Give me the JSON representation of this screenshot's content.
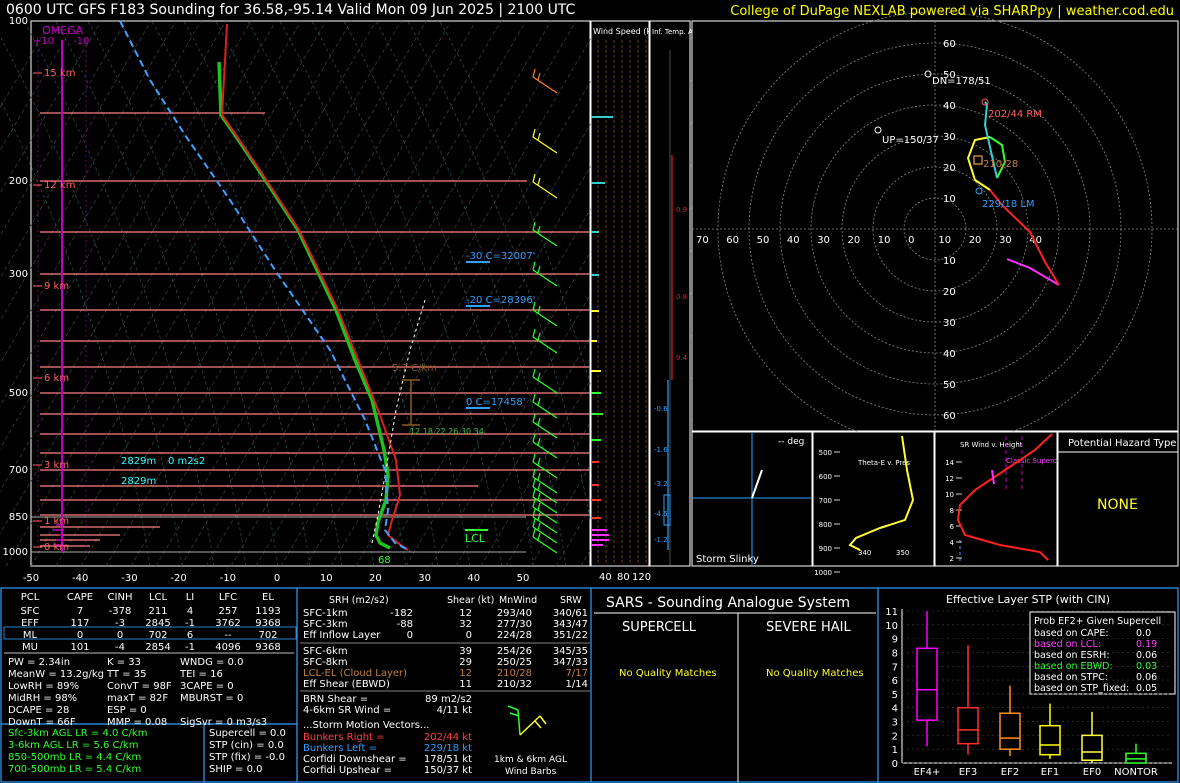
{
  "header": {
    "title": "0600 UTC GFS F183 Sounding for 36.58,-95.14 Valid  Mon 09 Jun 2025 | 2100 UTC",
    "credit": "College of DuPage NEXLAB powered via SHARPpy | weather.cod.edu"
  },
  "skewt": {
    "pressure_ticks": [
      "100",
      "200",
      "300",
      "500",
      "700",
      "850",
      "1000"
    ],
    "temp_ticks": [
      "-50",
      "-40",
      "-30",
      "-20",
      "-10",
      "0",
      "10",
      "20",
      "30",
      "40",
      "50"
    ],
    "height_labels": [
      "15 km",
      "12 km",
      "9 km",
      "6 km",
      "3 km",
      "1 km",
      "0 km"
    ],
    "omega_label": "OMEGA",
    "omega_ticks": [
      "+10",
      "-10"
    ],
    "annotations": {
      "wet_bulb_zero_1": "-30 C=32007'",
      "wet_bulb_zero_2": "-20 C=28396'",
      "freezing": "0 C=17458'",
      "lapse_max": "5.7 C/km",
      "eff_inflow_1": "2829m",
      "eff_inflow_srh": "0 m2s2",
      "eff_inflow_2": "2829m",
      "lcl": "LCL",
      "surface_temp": "68",
      "dendritic": "12  18  22 26 30 34"
    }
  },
  "wind_speed_panel": {
    "title": "Wind Speed (knots)",
    "ticks": [
      "40",
      "80",
      "120"
    ]
  },
  "temp_adv_panel": {
    "title": "Inf. Temp. Adv. (C/hr)",
    "values": [
      "0.9",
      "0.8",
      "0.4",
      "-0.6",
      "-1.6",
      "-3.2",
      "-4.5",
      "-1.2"
    ]
  },
  "hodograph": {
    "ring_labels": [
      "10",
      "20",
      "30",
      "40",
      "50",
      "60"
    ],
    "x_axis_labels": [
      "70",
      "60",
      "50",
      "40",
      "30",
      "20",
      "10",
      "0",
      "10",
      "20",
      "30",
      "40"
    ],
    "labels": {
      "dn": "DN=178/51",
      "up": "UP=150/37",
      "rm": "202/44 RM",
      "lm": "229/18 LM",
      "mean": "210/28"
    }
  },
  "storm_slinky": {
    "title": "Storm Slinky",
    "deg": "-- deg"
  },
  "theta_panel": {
    "title": "Theta-E v. Pres",
    "pres_ticks": [
      "500",
      "600",
      "700",
      "800",
      "900",
      "1000"
    ],
    "x_ticks": [
      "340",
      "350"
    ]
  },
  "sr_wind_panel": {
    "title": "SR Wind v. Height",
    "y_ticks": [
      "14",
      "12",
      "10",
      "8",
      "6",
      "4",
      "2"
    ],
    "classic": "Classic Supercell"
  },
  "hazard": {
    "title": "Potential Hazard Type",
    "value": "NONE"
  },
  "parcel_table": {
    "headers": [
      "PCL",
      "CAPE",
      "CINH",
      "LCL",
      "LI",
      "LFC",
      "EL"
    ],
    "rows": [
      [
        "SFC",
        "7",
        "-378",
        "211",
        "4",
        "257",
        "1193"
      ],
      [
        "EFF",
        "117",
        "-3",
        "2845",
        "-1",
        "3762",
        "9368"
      ],
      [
        "ML",
        "0",
        "0",
        "702",
        "6",
        "--",
        "702"
      ],
      [
        "MU",
        "101",
        "-4",
        "2854",
        "-1",
        "4096",
        "9368"
      ]
    ]
  },
  "indices": {
    "col1": [
      "PW = 2.34in",
      "MeanW = 13.2g/kg",
      "LowRH = 89%",
      "MidRH = 98%",
      "DCAPE = 28",
      "DownT = 66F"
    ],
    "col2": [
      "K = 33",
      "TT = 35",
      "ConvT = 98F",
      "maxT = 82F",
      "ESP = 0",
      "MMP = 0.08"
    ],
    "col3": [
      "WNDG = 0.0",
      "TEI = 16",
      "3CAPE = 0",
      "MBURST = 0",
      "",
      "SigSvr = 0 m3/s3"
    ]
  },
  "lapse_rates": [
    "Sfc-3km AGL LR = 4.0 C/km",
    "3-6km AGL LR = 5.6 C/km",
    "850-500mb LR = 4.4 C/km",
    "700-500mb LR = 5.4 C/km"
  ],
  "composite": [
    "Supercell = 0.0",
    "STP (cin) = 0.0",
    "STP (fix) = -0.0",
    "SHIP = 0.0"
  ],
  "kinematics": {
    "headers": [
      "SRH (m2/s2)",
      "Shear (kt)",
      "MnWind",
      "SRW"
    ],
    "rows": [
      {
        "label": "SFC-1km",
        "srh": "-182",
        "shear": "12",
        "mn": "293/40",
        "srw": "340/61",
        "color": "#fff"
      },
      {
        "label": "SFC-3km",
        "srh": "-88",
        "shear": "32",
        "mn": "277/30",
        "srw": "343/47",
        "color": "#fff"
      },
      {
        "label": "Eff Inflow Layer",
        "srh": "0",
        "shear": "0",
        "mn": "224/28",
        "srw": "351/22",
        "color": "#fff"
      },
      {
        "label": "SFC-6km",
        "srh": "",
        "shear": "39",
        "mn": "254/26",
        "srw": "345/35",
        "color": "#fff"
      },
      {
        "label": "SFC-8km",
        "srh": "",
        "shear": "29",
        "mn": "250/25",
        "srw": "347/33",
        "color": "#fff"
      },
      {
        "label": "LCL-EL (Cloud Layer)",
        "srh": "",
        "shear": "12",
        "mn": "210/28",
        "srw": "7/17",
        "color": "#c08040"
      },
      {
        "label": "Eff Shear (EBWD)",
        "srh": "",
        "shear": "11",
        "mn": "210/32",
        "srw": "1/14",
        "color": "#fff"
      }
    ],
    "brn_label": "BRN Shear =",
    "brn_value": "89 m2/s2",
    "sr46_label": "4-6km SR Wind =",
    "sr46_value": "4/11 kt",
    "storm_motion_title": "...Storm Motion Vectors...",
    "motions": [
      {
        "label": "Bunkers Right =",
        "value": "202/44 kt",
        "color": "#ff4040"
      },
      {
        "label": "Bunkers Left =",
        "value": "229/18 kt",
        "color": "#30a0ff"
      },
      {
        "label": "Corfidi Downshear =",
        "value": "178/51 kt",
        "color": "#fff"
      },
      {
        "label": "Corfidi Upshear =",
        "value": "150/37 kt",
        "color": "#fff"
      }
    ],
    "barb_caption": "1km & 6km AGL Wind Barbs"
  },
  "sars": {
    "title": "SARS - Sounding Analogue System",
    "supercell": "SUPERCELL",
    "hail": "SEVERE HAIL",
    "supercell_result": "No Quality Matches",
    "hail_result": "No Quality Matches"
  },
  "stp_chart": {
    "title": "Effective Layer STP (with CIN)",
    "prob_title": "Prob EF2+ Given Supercell",
    "probs": [
      {
        "label": "based on CAPE:",
        "value": "0.0",
        "color": "#fff"
      },
      {
        "label": "based on LCL:",
        "value": "0.19",
        "color": "#ff40ff"
      },
      {
        "label": "based on ESRH:",
        "value": "0.06",
        "color": "#fff"
      },
      {
        "label": "based on EBWD:",
        "value": "0.03",
        "color": "#30ff30"
      },
      {
        "label": "based on STPC:",
        "value": "0.06",
        "color": "#fff"
      },
      {
        "label": "based on STP_fixed:",
        "value": "0.05",
        "color": "#fff"
      }
    ]
  },
  "chart_data": {
    "type": "box",
    "title": "Effective Layer STP (with CIN)",
    "categories": [
      "EF4+",
      "EF3",
      "EF2",
      "EF1",
      "EF0",
      "NONTOR"
    ],
    "colors": [
      "#ff00ff",
      "#ff3030",
      "#ff9020",
      "#ffff00",
      "#ffff40",
      "#30ff30"
    ],
    "boxes": [
      {
        "whisker_low": 1.2,
        "q1": 3.1,
        "median": 5.3,
        "q3": 8.3,
        "whisker_high": 11.0
      },
      {
        "whisker_low": 0.6,
        "q1": 1.4,
        "median": 2.4,
        "q3": 4.0,
        "whisker_high": 8.5
      },
      {
        "whisker_low": 0.5,
        "q1": 1.0,
        "median": 1.8,
        "q3": 3.6,
        "whisker_high": 5.6
      },
      {
        "whisker_low": 0.3,
        "q1": 0.6,
        "median": 1.3,
        "q3": 2.7,
        "whisker_high": 4.3
      },
      {
        "whisker_low": 0.0,
        "q1": 0.2,
        "median": 0.8,
        "q3": 2.0,
        "whisker_high": 3.7
      },
      {
        "whisker_low": 0.0,
        "q1": 0.0,
        "median": 0.3,
        "q3": 0.7,
        "whisker_high": 1.4
      }
    ],
    "ylim": [
      0,
      11
    ],
    "yticks": [
      "0",
      "1",
      "2",
      "3",
      "4",
      "5",
      "6",
      "7",
      "8",
      "9",
      "10",
      "11"
    ]
  }
}
